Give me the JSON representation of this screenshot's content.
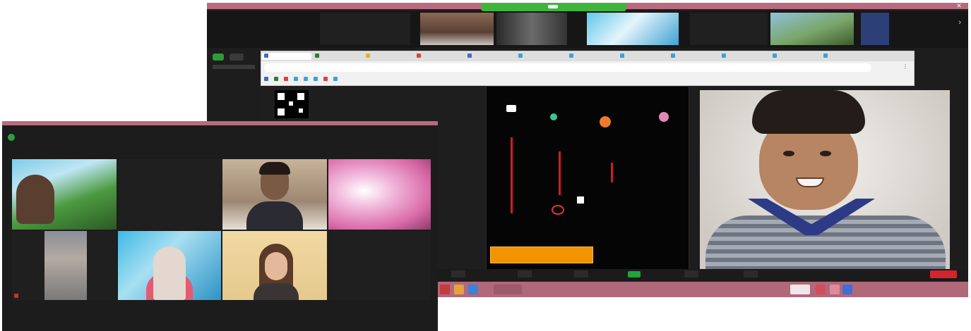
{
  "back_window": {
    "strip": {
      "tiles": [
        {
          "name": "",
          "label": ""
        },
        {
          "name": ""
        },
        {
          "name": ""
        },
        {
          "name": ""
        },
        {
          "name": "",
          "label": ""
        },
        {
          "name": ""
        },
        {
          "name": ""
        }
      ]
    },
    "browser": {
      "tabs": [
        "",
        "",
        "",
        "",
        "",
        "",
        "",
        "",
        "",
        "",
        "",
        ""
      ],
      "address": "",
      "bookmarks": [
        "",
        "",
        "",
        "",
        "",
        "",
        "",
        ""
      ]
    },
    "game": {
      "title_line1": "",
      "title_line2": "",
      "button_label": ""
    },
    "control_bar": {
      "leave_label": ""
    },
    "taskbar": {
      "clock": ""
    }
  },
  "front_window": {
    "header": {
      "left_text": "",
      "right_text": ""
    },
    "tiles": [
      {
        "name": ""
      },
      {
        "center_name": ""
      },
      {
        "name": ""
      },
      {
        "name": ""
      },
      {
        "name": ""
      },
      {
        "name": ""
      },
      {
        "name": ""
      },
      {
        "center_name": ""
      }
    ]
  },
  "colors": {
    "title_bar": "#b86a7e",
    "taskbar": "#b0687b",
    "green_banner": "#3fb43c",
    "orange_button": "#f29400",
    "leave_red": "#d4252f"
  },
  "icons": [
    "security-shield-icon",
    "close-icon",
    "chevron-right-icon",
    "mute-icon"
  ]
}
